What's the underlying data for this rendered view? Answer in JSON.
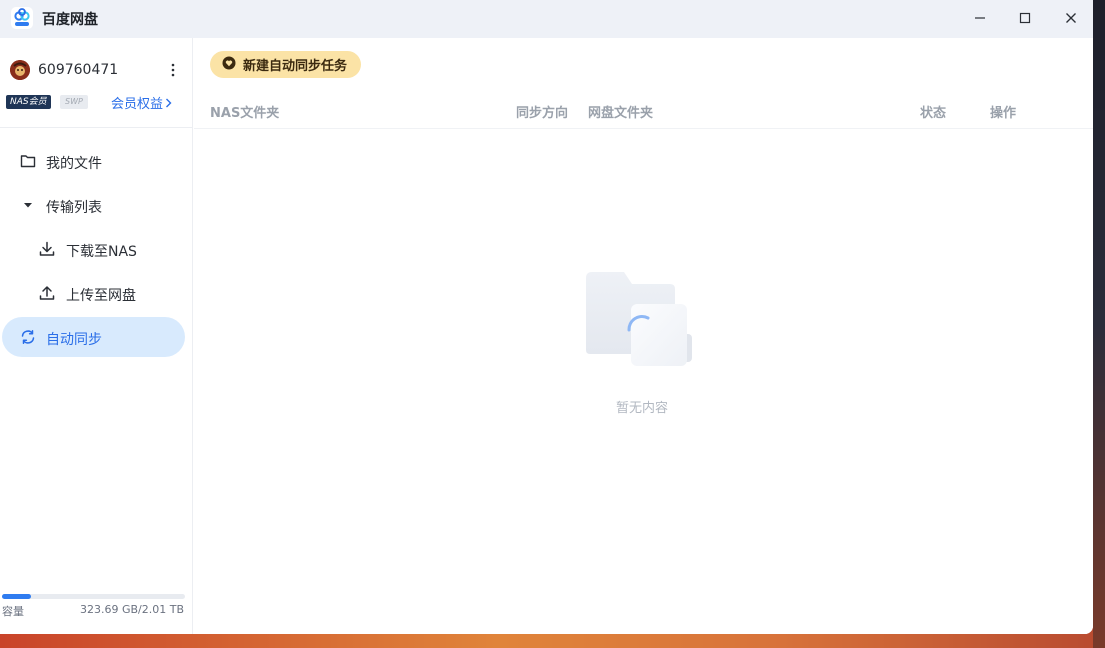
{
  "window": {
    "title": "百度网盘",
    "controls": [
      "minimize",
      "maximize",
      "close"
    ]
  },
  "user": {
    "id": "609760471",
    "badge_nas": "NAS会员",
    "badge_swp": "SWP",
    "member_link": "会员权益"
  },
  "sidebar": {
    "items": [
      {
        "label": "我的文件",
        "icon": "folder-icon"
      },
      {
        "label": "传输列表",
        "icon": "caret-down-icon"
      },
      {
        "label": "下载至NAS",
        "icon": "download-icon"
      },
      {
        "label": "上传至网盘",
        "icon": "upload-icon"
      },
      {
        "label": "自动同步",
        "icon": "sync-icon",
        "active": true
      }
    ]
  },
  "storage": {
    "label": "容量",
    "value": "323.69 GB/2.01 TB",
    "used_fraction": 0.157
  },
  "main": {
    "new_task_button": "新建自动同步任务",
    "columns": [
      "NAS文件夹",
      "同步方向",
      "网盘文件夹",
      "状态",
      "操作"
    ],
    "empty_text": "暂无内容"
  },
  "colors": {
    "accent": "#2a6ee8",
    "active_bg": "#d8eafd",
    "new_task_bg": "#fbe3a6"
  }
}
